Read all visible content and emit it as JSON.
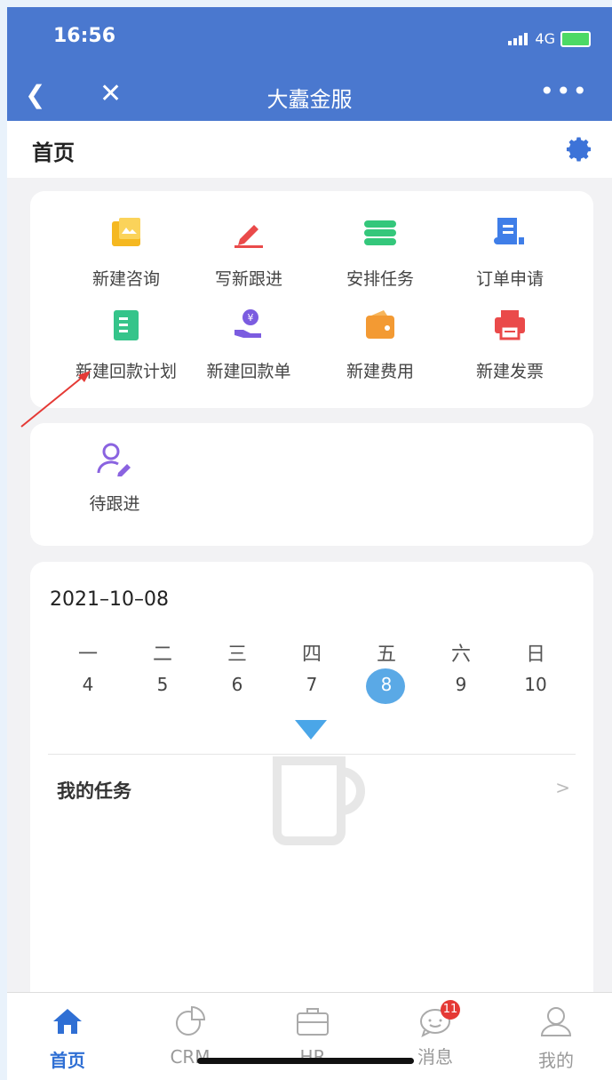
{
  "status_bar": {
    "time": "16:56",
    "network": "4G"
  },
  "navbar": {
    "title": "大蠹金服"
  },
  "page_header": {
    "title": "首页"
  },
  "quick_actions": [
    {
      "label": "新建咨询",
      "icon": "consult-icon",
      "color": "#f5b820"
    },
    {
      "label": "写新跟进",
      "icon": "pen-icon",
      "color": "#ea4a4a"
    },
    {
      "label": "安排任务",
      "icon": "task-stack-icon",
      "color": "#34c77b"
    },
    {
      "label": "订单申请",
      "icon": "order-doc-icon",
      "color": "#3f7ee8"
    },
    {
      "label": "新建回款计划",
      "icon": "payment-plan-icon",
      "color": "#35c48a"
    },
    {
      "label": "新建回款单",
      "icon": "payment-hand-icon",
      "color": "#7b5ce0"
    },
    {
      "label": "新建费用",
      "icon": "wallet-icon",
      "color": "#f39a33"
    },
    {
      "label": "新建发票",
      "icon": "printer-icon",
      "color": "#ea4a4a"
    }
  ],
  "todo": {
    "label": "待跟进",
    "icon": "user-edit-icon"
  },
  "calendar": {
    "date": "2021–10–08",
    "weekdays": [
      "一",
      "二",
      "三",
      "四",
      "五",
      "六",
      "日"
    ],
    "days": [
      "4",
      "5",
      "6",
      "7",
      "8",
      "9",
      "10"
    ],
    "selected_day": "8"
  },
  "my_tasks": {
    "label": "我的任务"
  },
  "tabbar": [
    {
      "label": "首页",
      "icon": "home-icon",
      "active": true
    },
    {
      "label": "CRM",
      "icon": "chart-icon",
      "active": false
    },
    {
      "label": "HR",
      "icon": "briefcase-icon",
      "active": false
    },
    {
      "label": "消息",
      "icon": "message-icon",
      "active": false,
      "badge": "11"
    },
    {
      "label": "我的",
      "icon": "profile-icon",
      "active": false
    }
  ]
}
